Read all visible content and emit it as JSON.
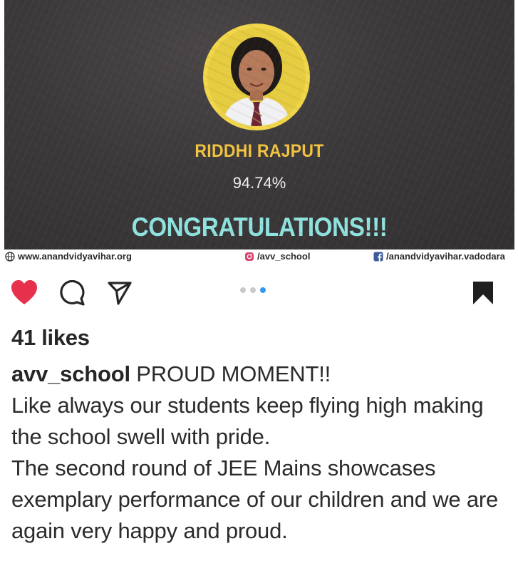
{
  "post": {
    "student_name": "RIDDHI RAJPUT",
    "score": "94.74%",
    "banner": "CONGRATULATIONS!!!",
    "footer": {
      "website": "www.anandvidyavihar.org",
      "instagram": "/avv_school",
      "facebook": "/anandvidyavihar.vadodara"
    }
  },
  "actions": {
    "icons": [
      "heart-icon",
      "comment-icon",
      "share-icon",
      "bookmark-icon"
    ],
    "carousel_active_index": 2,
    "carousel_count": 3,
    "colors": {
      "heart": "#e7304b",
      "active_dot": "#3797e8"
    }
  },
  "likes": "41 likes",
  "caption": {
    "username": "avv_school",
    "line1": "PROUD MOMENT!!",
    "line2": "Like always our students keep flying high making the school swell with pride.",
    "line3": "The second round of JEE Mains showcases exemplary performance of our children and we are again very happy and proud."
  }
}
